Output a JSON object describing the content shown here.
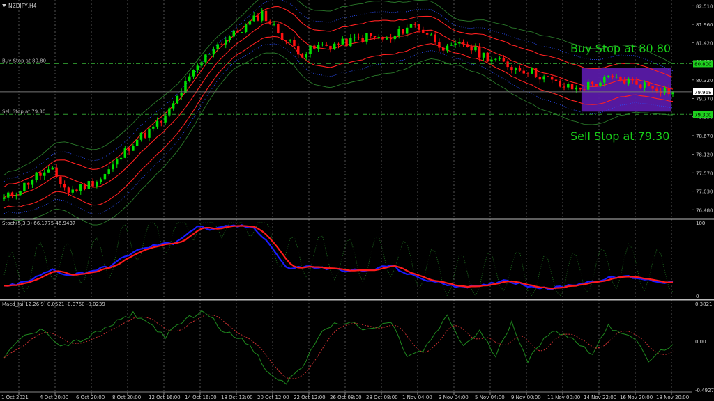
{
  "window": {
    "symbol_title": "NZDJPY,H4"
  },
  "main_pane": {
    "price_ticks": [
      "82.510",
      "81.960",
      "81.420",
      "80.870",
      "80.320",
      "79.770",
      "79.230",
      "78.670",
      "78.120",
      "77.570",
      "77.030",
      "76.480"
    ],
    "current_price": "79.968",
    "buy_level": {
      "tag": "80.800",
      "label": "Buy Stop at 80.80",
      "annotation": "Buy Stop at 80.80"
    },
    "sell_level": {
      "tag": "79.300",
      "label": "Sell Stop at 79.30",
      "annotation": "Sell Stop at 79.30"
    },
    "colors": {
      "bull": "#00e000",
      "bear": "#ff1010",
      "bands": "#2a7a2a",
      "middle_bands": "#ff2020",
      "box": "#5a1aa8",
      "level_line": "#2f9a2f"
    }
  },
  "stoch_pane": {
    "label": "Stoch(5,3,3) 66.1775 46.9437",
    "ticks": [
      "100",
      "0"
    ],
    "colors": {
      "main": "#1a1aff",
      "signal": "#ff1a1a",
      "raw": "#1f6f1f"
    }
  },
  "macd_pane": {
    "label": "Macd_Jai(12,26,9) 0.0521 -0.0760 -0.0239",
    "ticks": [
      "0.3821",
      "0.00",
      "-0.4927"
    ],
    "colors": {
      "macd": "#1f8a1f",
      "signal": "#c83030"
    }
  },
  "time_axis": [
    "1 Oct 2021",
    "4 Oct 20:00",
    "6 Oct 20:00",
    "8 Oct 20:00",
    "12 Oct 16:00",
    "14 Oct 16:00",
    "18 Oct 12:00",
    "20 Oct 12:00",
    "22 Oct 12:00",
    "26 Oct 08:00",
    "28 Oct 08:00",
    "1 Nov 04:00",
    "3 Nov 04:00",
    "5 Nov 04:00",
    "9 Nov 00:00",
    "11 Nov 00:00",
    "14 Nov 22:00",
    "16 Nov 20:00",
    "18 Nov 20:00"
  ],
  "chart_data": {
    "type": "candlestick",
    "price_key": [
      [
        0,
        76.8
      ],
      [
        4,
        77.1
      ],
      [
        8,
        77.5
      ],
      [
        12,
        77.6
      ],
      [
        16,
        77.0
      ],
      [
        20,
        77.2
      ],
      [
        24,
        77.4
      ],
      [
        28,
        77.9
      ],
      [
        32,
        78.5
      ],
      [
        36,
        78.8
      ],
      [
        40,
        79.2
      ],
      [
        44,
        80.0
      ],
      [
        48,
        80.7
      ],
      [
        52,
        81.3
      ],
      [
        56,
        81.6
      ],
      [
        60,
        81.9
      ],
      [
        64,
        82.3
      ],
      [
        66,
        82.0
      ],
      [
        70,
        81.5
      ],
      [
        74,
        81.1
      ],
      [
        78,
        81.3
      ],
      [
        84,
        81.4
      ],
      [
        90,
        81.6
      ],
      [
        96,
        81.5
      ],
      [
        100,
        81.9
      ],
      [
        102,
        81.95
      ],
      [
        106,
        81.6
      ],
      [
        110,
        81.2
      ],
      [
        114,
        81.4
      ],
      [
        118,
        81.1
      ],
      [
        122,
        80.9
      ],
      [
        126,
        80.7
      ],
      [
        130,
        80.6
      ],
      [
        134,
        80.4
      ],
      [
        138,
        80.15
      ],
      [
        142,
        80.05
      ],
      [
        146,
        80.2
      ],
      [
        150,
        80.35
      ],
      [
        154,
        80.3
      ],
      [
        158,
        80.2
      ],
      [
        162,
        80.1
      ],
      [
        166,
        79.95
      ]
    ],
    "stoch_key": [
      [
        0,
        12
      ],
      [
        6,
        20
      ],
      [
        12,
        36
      ],
      [
        16,
        28
      ],
      [
        20,
        32
      ],
      [
        26,
        40
      ],
      [
        32,
        60
      ],
      [
        38,
        70
      ],
      [
        42,
        72
      ],
      [
        48,
        95
      ],
      [
        52,
        90
      ],
      [
        56,
        96
      ],
      [
        62,
        94
      ],
      [
        66,
        70
      ],
      [
        70,
        38
      ],
      [
        76,
        40
      ],
      [
        82,
        36
      ],
      [
        90,
        34
      ],
      [
        96,
        42
      ],
      [
        100,
        30
      ],
      [
        106,
        20
      ],
      [
        112,
        14
      ],
      [
        118,
        12
      ],
      [
        124,
        22
      ],
      [
        130,
        14
      ],
      [
        136,
        10
      ],
      [
        142,
        16
      ],
      [
        148,
        22
      ],
      [
        154,
        27
      ],
      [
        158,
        24
      ],
      [
        162,
        20
      ],
      [
        166,
        18
      ]
    ],
    "macd_key": [
      [
        0,
        -0.15
      ],
      [
        5,
        0.05
      ],
      [
        10,
        0.12
      ],
      [
        14,
        -0.05
      ],
      [
        20,
        0.02
      ],
      [
        26,
        0.15
      ],
      [
        32,
        0.28
      ],
      [
        36,
        0.18
      ],
      [
        40,
        0.05
      ],
      [
        46,
        0.25
      ],
      [
        50,
        0.3
      ],
      [
        54,
        0.12
      ],
      [
        58,
        0.05
      ],
      [
        62,
        -0.1
      ],
      [
        66,
        -0.35
      ],
      [
        70,
        -0.42
      ],
      [
        74,
        -0.25
      ],
      [
        80,
        0.15
      ],
      [
        86,
        0.2
      ],
      [
        90,
        0.1
      ],
      [
        96,
        0.2
      ],
      [
        100,
        -0.15
      ],
      [
        104,
        -0.1
      ],
      [
        110,
        0.25
      ],
      [
        114,
        -0.05
      ],
      [
        118,
        0.1
      ],
      [
        122,
        -0.15
      ],
      [
        126,
        0.2
      ],
      [
        130,
        -0.2
      ],
      [
        136,
        0.12
      ],
      [
        140,
        0.05
      ],
      [
        146,
        -0.12
      ],
      [
        150,
        0.15
      ],
      [
        156,
        0.05
      ],
      [
        160,
        -0.2
      ],
      [
        166,
        -0.02
      ]
    ],
    "buy_stop": 80.8,
    "sell_stop": 79.3,
    "range_box": {
      "from_bar": 144,
      "to_bar": 166,
      "top": 80.8,
      "bottom": 79.3
    }
  }
}
